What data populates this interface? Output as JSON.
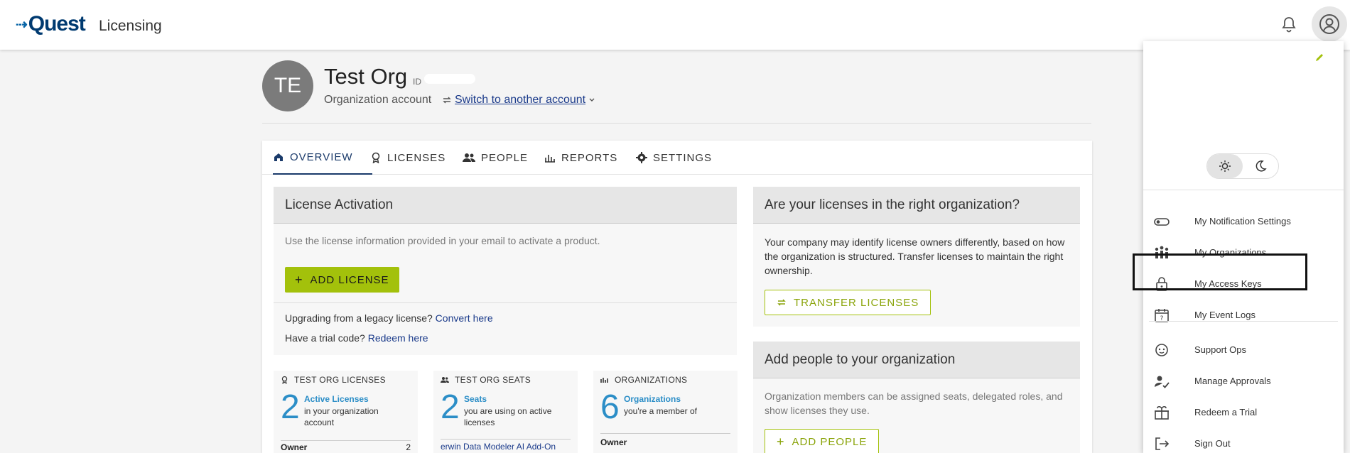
{
  "app": {
    "logo": "Quest",
    "name": "Licensing"
  },
  "org": {
    "avatar_initials": "TE",
    "name": "Test Org",
    "id_label": "ID",
    "type": "Organization account",
    "switch_label": "Switch to another account"
  },
  "tabs": [
    {
      "label": "OVERVIEW",
      "icon": "home-icon",
      "active": true
    },
    {
      "label": "LICENSES",
      "icon": "license-badge-icon"
    },
    {
      "label": "PEOPLE",
      "icon": "people-icon"
    },
    {
      "label": "REPORTS",
      "icon": "reports-icon"
    },
    {
      "label": "SETTINGS",
      "icon": "gear-icon"
    }
  ],
  "license_activation": {
    "title": "License Activation",
    "description": "Use the license information provided in your email to activate a product.",
    "add_button": "ADD LICENSE",
    "legacy_text": "Upgrading from a legacy license?",
    "legacy_link": "Convert here",
    "trial_text": "Have a trial code?",
    "trial_link": "Redeem here"
  },
  "right_org": {
    "title": "Are your licenses in the right organization?",
    "description": "Your company may identify license owners differently, based on how the organization is structured. Transfer licenses to maintain the right ownership.",
    "button": "TRANSFER LICENSES"
  },
  "add_people": {
    "title": "Add people to your organization",
    "description": "Organization members can be assigned seats, delegated roles, and show licenses they use.",
    "button": "ADD PEOPLE"
  },
  "stats": [
    {
      "title": "TEST ORG LICENSES",
      "number": "2",
      "link": "Active Licenses",
      "desc": "in your organization account",
      "foot_label": "Owner",
      "foot_value": "2"
    },
    {
      "title": "TEST ORG SEATS",
      "number": "2",
      "link": "Seats",
      "desc": "you are using on active licenses",
      "foot_label": "erwin Data Modeler AI Add-On"
    },
    {
      "title": "ORGANIZATIONS",
      "number": "6",
      "link": "Organizations",
      "desc": "you're a member of",
      "foot_label": "Owner"
    }
  ],
  "user_menu": {
    "items": [
      {
        "label": "My Notification Settings",
        "icon": "toggle-icon"
      },
      {
        "label": "My Organizations",
        "icon": "organizations-icon"
      },
      {
        "label": "My Access Keys",
        "icon": "lock-icon"
      },
      {
        "label": "My Event Logs",
        "icon": "calendar-question-icon"
      },
      {
        "label": "Support Ops",
        "icon": "support-icon"
      },
      {
        "label": "Manage Approvals",
        "icon": "approval-icon"
      },
      {
        "label": "Redeem a Trial",
        "icon": "gift-icon"
      },
      {
        "label": "Sign Out",
        "icon": "sign-out-icon"
      }
    ]
  },
  "colors": {
    "accent_green": "#a3c10b",
    "link_blue": "#1a3a8a",
    "stat_blue": "#2c8ec7",
    "brand_navy": "#003a70"
  }
}
